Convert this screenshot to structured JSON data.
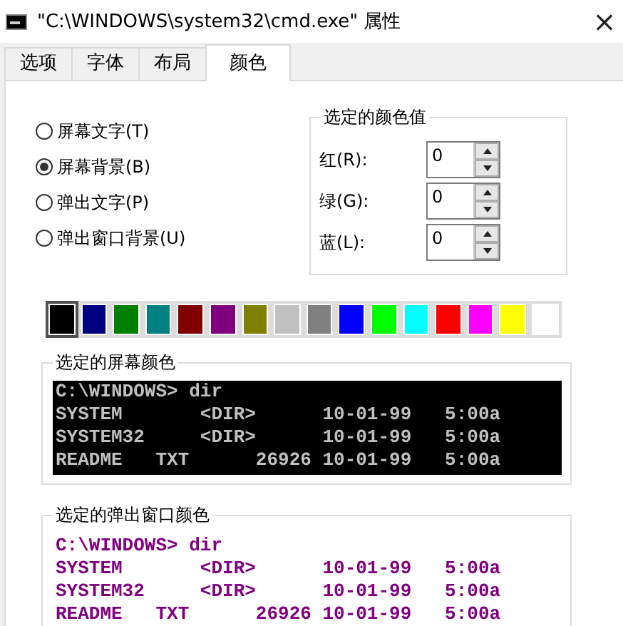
{
  "window": {
    "title": "\"C:\\WINDOWS\\system32\\cmd.exe\" 属性",
    "close": "×"
  },
  "tabs": [
    {
      "label": "选项",
      "selected": false
    },
    {
      "label": "字体",
      "selected": false
    },
    {
      "label": "布局",
      "selected": false
    },
    {
      "label": "颜色",
      "selected": true
    }
  ],
  "radios": [
    {
      "label": "屏幕文字(T)",
      "selected": false
    },
    {
      "label": "屏幕背景(B)",
      "selected": true
    },
    {
      "label": "弹出文字(P)",
      "selected": false
    },
    {
      "label": "弹出窗口背景(U)",
      "selected": false
    }
  ],
  "color_values": {
    "title": "选定的颜色值",
    "fields": [
      {
        "label": "红(R):",
        "value": "0"
      },
      {
        "label": "绿(G):",
        "value": "0"
      },
      {
        "label": "蓝(L):",
        "value": "0"
      }
    ]
  },
  "swatches": [
    {
      "color": "#000000",
      "selected": true
    },
    {
      "color": "#000080",
      "selected": false
    },
    {
      "color": "#008000",
      "selected": false
    },
    {
      "color": "#008080",
      "selected": false
    },
    {
      "color": "#800000",
      "selected": false
    },
    {
      "color": "#800080",
      "selected": false
    },
    {
      "color": "#808000",
      "selected": false
    },
    {
      "color": "#c0c0c0",
      "selected": false
    },
    {
      "color": "#808080",
      "selected": false
    },
    {
      "color": "#0000ff",
      "selected": false
    },
    {
      "color": "#00ff00",
      "selected": false
    },
    {
      "color": "#00ffff",
      "selected": false
    },
    {
      "color": "#ff0000",
      "selected": false
    },
    {
      "color": "#ff00ff",
      "selected": false
    },
    {
      "color": "#ffff00",
      "selected": false
    },
    {
      "color": "#ffffff",
      "selected": false
    }
  ],
  "previews": [
    {
      "title": "选定的屏幕颜色",
      "text": {
        "color": "#c0c0c0"
      },
      "background": {
        "color": "#000000"
      },
      "lines": [
        "C:\\WINDOWS> dir",
        "SYSTEM       <DIR>      10-01-99   5:00a",
        "SYSTEM32     <DIR>      10-01-99   5:00a",
        "README   TXT      26926 10-01-99   5:00a"
      ]
    },
    {
      "title": "选定的弹出窗口颜色",
      "text": {
        "color": "#800080"
      },
      "background": {
        "color": "#ffffff"
      },
      "lines": [
        "C:\\WINDOWS> dir",
        "SYSTEM       <DIR>      10-01-99   5:00a",
        "SYSTEM32     <DIR>      10-01-99   5:00a",
        "README   TXT      26926 10-01-99   5:00a"
      ]
    }
  ]
}
